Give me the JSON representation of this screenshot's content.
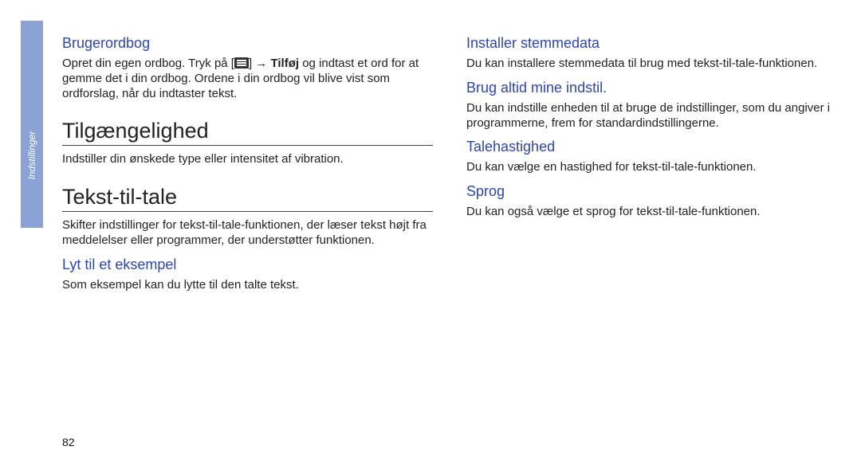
{
  "side_tab": {
    "label": "Indstillinger"
  },
  "page_number": "82",
  "left": {
    "h_brugerordbog": "Brugerordbog",
    "brugerordbog_p1a": "Opret din egen ordbog. Tryk på [",
    "brugerordbog_p1b": "] → ",
    "brugerordbog_p1_bold": "Tilføj",
    "brugerordbog_p1c": " og indtast et ord for at gemme det i din ordbog. Ordene i din ordbog vil blive vist som ordforslag, når du indtaster tekst.",
    "h_tilg": "Tilgængelighed",
    "tilg_p": "Indstiller din ønskede type eller intensitet af vibration.",
    "h_ttt": "Tekst-til-tale",
    "ttt_p": "Skifter indstillinger for tekst-til-tale-funktionen, der læser tekst højt fra meddelelser eller programmer, der understøtter funktionen.",
    "h_lyt": "Lyt til et eksempel",
    "lyt_p": "Som eksempel kan du lytte til den talte tekst."
  },
  "right": {
    "h_installer": "Installer stemmedata",
    "installer_p": "Du kan installere stemmedata til brug med tekst-til-tale-funktionen.",
    "h_brug": "Brug altid mine indstil.",
    "brug_p": "Du kan indstille enheden til at bruge de indstillinger, som du angiver i programmerne, frem for standardindstillingerne.",
    "h_tale": "Talehastighed",
    "tale_p": "Du kan vælge en hastighed for tekst-til-tale-funktionen.",
    "h_sprog": "Sprog",
    "sprog_p": "Du kan også vælge et sprog for tekst-til-tale-funktionen."
  }
}
